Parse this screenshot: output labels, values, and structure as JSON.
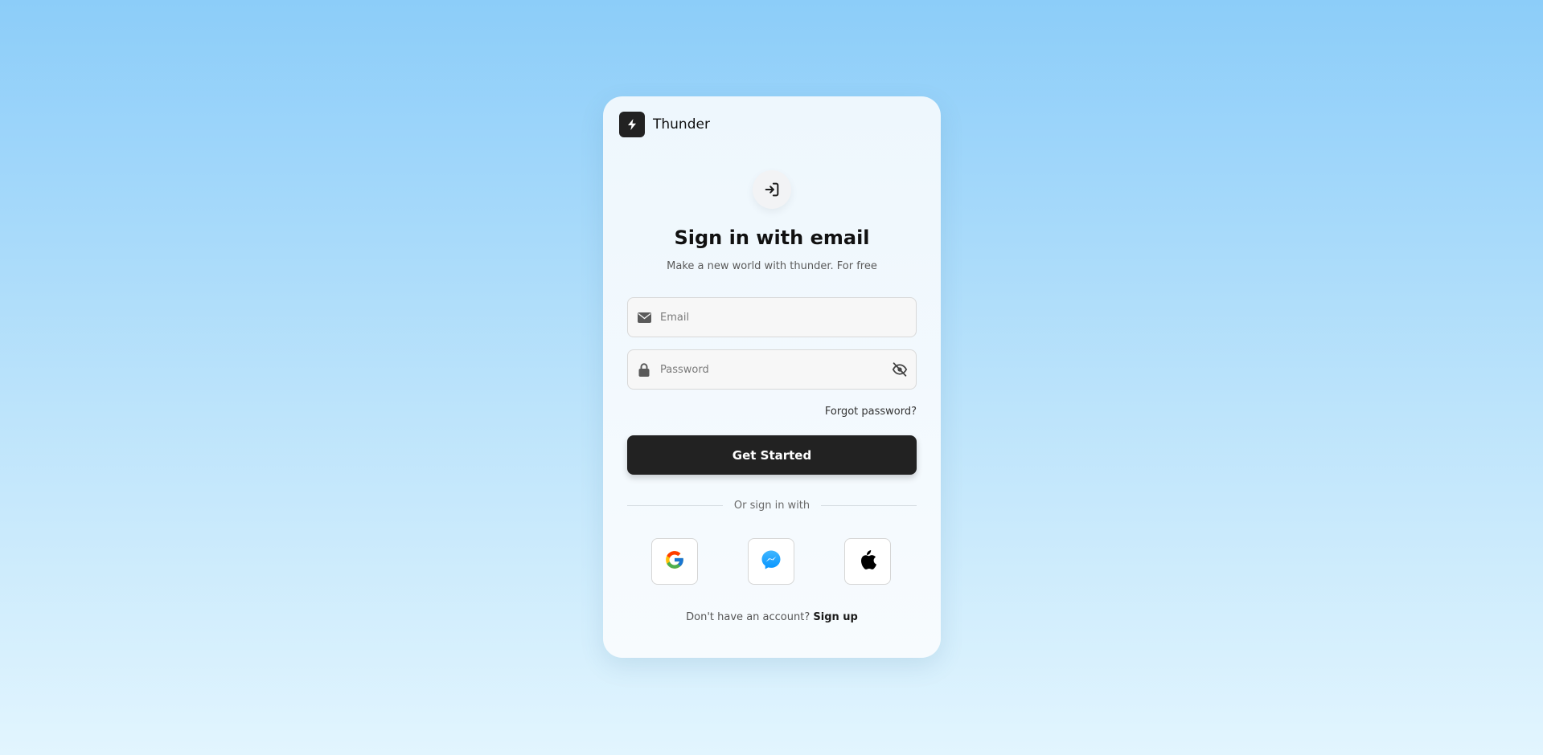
{
  "brand": {
    "name": "Thunder",
    "logo_icon": "lightning-bolt-icon"
  },
  "header": {
    "badge_icon": "sign-in-arrow-icon",
    "title": "Sign in with email",
    "subtitle": "Make a new world with thunder. For free"
  },
  "form": {
    "email": {
      "placeholder": "Email",
      "value": "",
      "icon": "envelope-icon"
    },
    "password": {
      "placeholder": "Password",
      "value": "",
      "icon": "lock-icon",
      "toggle_icon": "eye-slash-icon"
    },
    "forgot_label": "Forgot password?",
    "submit_label": "Get Started"
  },
  "divider": {
    "label": "Or sign in with"
  },
  "social": [
    {
      "name": "google",
      "icon": "google-icon"
    },
    {
      "name": "messenger",
      "icon": "messenger-icon",
      "color": "#0a84ff"
    },
    {
      "name": "apple",
      "icon": "apple-icon",
      "color": "#000000"
    }
  ],
  "footer": {
    "prompt": "Don't have an account?",
    "signup_label": "Sign up"
  },
  "colors": {
    "primary": "#222222",
    "background_top": "#8ccdf9",
    "background_bottom": "#e2f5fe",
    "card": "#f4f9fd"
  }
}
